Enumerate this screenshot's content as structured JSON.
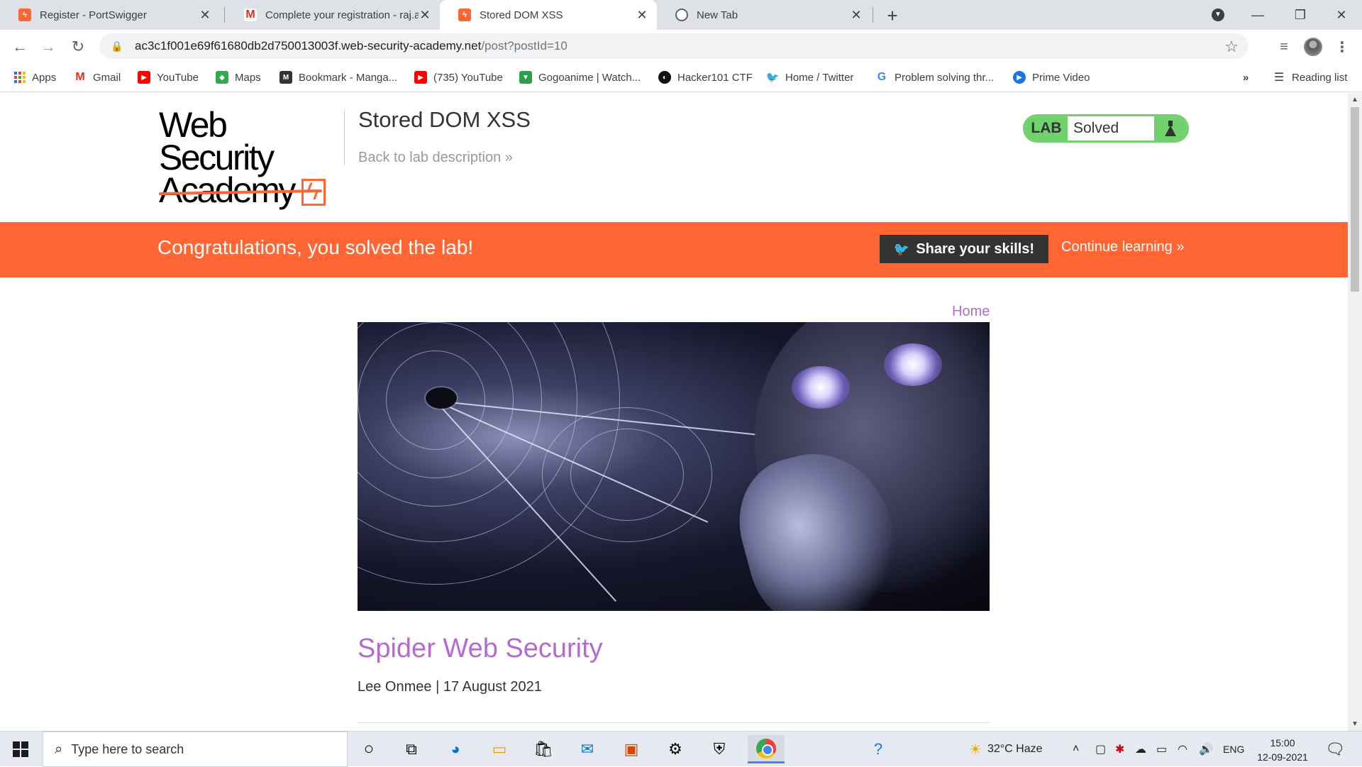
{
  "browser": {
    "tabs": [
      {
        "title": "Register - PortSwigger",
        "favicon": "portswigger-icon"
      },
      {
        "title": "Complete your registration - raj.a",
        "favicon": "gmail-icon"
      },
      {
        "title": "Stored DOM XSS",
        "favicon": "portswigger-icon",
        "active": true
      },
      {
        "title": "New Tab",
        "favicon": "chrome-icon"
      }
    ],
    "url_host": "ac3c1f001e69f61680db2d750013003f.web-security-academy.net",
    "url_path": "/post?postId=10",
    "bookmarks": [
      {
        "label": "Apps",
        "icon": "apps-grid-icon"
      },
      {
        "label": "Gmail",
        "icon": "gmail-icon"
      },
      {
        "label": "YouTube",
        "icon": "youtube-icon"
      },
      {
        "label": "Maps",
        "icon": "maps-icon"
      },
      {
        "label": "Bookmark - Manga...",
        "icon": "manga-icon"
      },
      {
        "label": "(735) YouTube",
        "icon": "youtube-icon"
      },
      {
        "label": "Gogoanime | Watch...",
        "icon": "gogoanime-icon"
      },
      {
        "label": "Hacker101 CTF",
        "icon": "hacker101-icon"
      },
      {
        "label": "Home / Twitter",
        "icon": "twitter-icon"
      },
      {
        "label": "Problem solving thr...",
        "icon": "google-icon"
      },
      {
        "label": "Prime Video",
        "icon": "prime-video-icon"
      }
    ],
    "overflow_label": "»",
    "reading_list": "Reading list"
  },
  "page": {
    "logo_line1": "Web Security",
    "logo_line2": "Academy",
    "lab_title": "Stored DOM XSS",
    "back_link": "Back to lab description »",
    "lab_badge": "LAB",
    "lab_state": "Solved",
    "banner_message": "Congratulations, you solved the lab!",
    "share_button": "Share your skills!",
    "continue_link": "Continue learning »",
    "home_link": "Home",
    "post_title": "Spider Web Security",
    "post_meta": "Lee Onmee | 17 August 2021"
  },
  "taskbar": {
    "search_placeholder": "Type here to search",
    "weather": "32°C  Haze",
    "language": "ENG",
    "time": "15:00",
    "date": "12-09-2021"
  },
  "colors": {
    "accent_orange": "#ff6633",
    "solved_green": "#70d16d",
    "link_purple": "#b36bd1"
  }
}
